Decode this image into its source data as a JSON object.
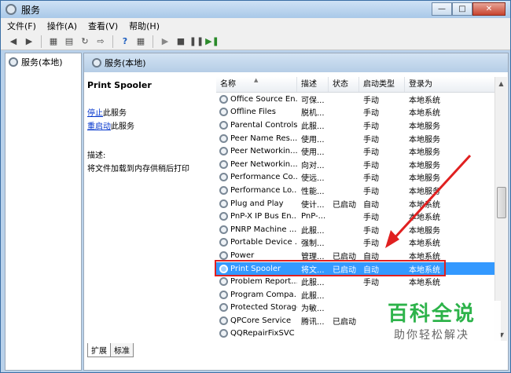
{
  "window": {
    "title": "服务"
  },
  "menu": [
    "文件(F)",
    "操作(A)",
    "查看(V)",
    "帮助(H)"
  ],
  "tree": {
    "root_label": "服务(本地)"
  },
  "main_header": {
    "title": "服务(本地)"
  },
  "details": {
    "service_name": "Print Spooler",
    "stop_link": "停止",
    "stop_suffix": "此服务",
    "restart_link": "重启动",
    "restart_suffix": "此服务",
    "desc_label": "描述:",
    "desc_text": "将文件加载到内存供稍后打印"
  },
  "columns": [
    "名称",
    "描述",
    "状态",
    "启动类型",
    "登录为"
  ],
  "rows": [
    {
      "name": "Office Source En...",
      "desc": "可保...",
      "status": "",
      "startup": "手动",
      "logon": "本地系统"
    },
    {
      "name": "Offline Files",
      "desc": "脱机...",
      "status": "",
      "startup": "手动",
      "logon": "本地系统"
    },
    {
      "name": "Parental Controls",
      "desc": "此服...",
      "status": "",
      "startup": "手动",
      "logon": "本地服务"
    },
    {
      "name": "Peer Name Res...",
      "desc": "使用...",
      "status": "",
      "startup": "手动",
      "logon": "本地服务"
    },
    {
      "name": "Peer Networkin...",
      "desc": "使用...",
      "status": "",
      "startup": "手动",
      "logon": "本地服务"
    },
    {
      "name": "Peer Networkin...",
      "desc": "向对...",
      "status": "",
      "startup": "手动",
      "logon": "本地服务"
    },
    {
      "name": "Performance Co...",
      "desc": "使远...",
      "status": "",
      "startup": "手动",
      "logon": "本地服务"
    },
    {
      "name": "Performance Lo...",
      "desc": "性能...",
      "status": "",
      "startup": "手动",
      "logon": "本地服务"
    },
    {
      "name": "Plug and Play",
      "desc": "使计...",
      "status": "已启动",
      "startup": "自动",
      "logon": "本地系统"
    },
    {
      "name": "PnP-X IP Bus En...",
      "desc": "PnP-...",
      "status": "",
      "startup": "手动",
      "logon": "本地系统"
    },
    {
      "name": "PNRP Machine ...",
      "desc": "此服...",
      "status": "",
      "startup": "手动",
      "logon": "本地服务"
    },
    {
      "name": "Portable Device ...",
      "desc": "强制...",
      "status": "",
      "startup": "手动",
      "logon": "本地系统"
    },
    {
      "name": "Power",
      "desc": "管理...",
      "status": "已启动",
      "startup": "自动",
      "logon": "本地系统"
    },
    {
      "name": "Print Spooler",
      "desc": "将文...",
      "status": "已启动",
      "startup": "自动",
      "logon": "本地系统",
      "selected": true
    },
    {
      "name": "Problem Report...",
      "desc": "此服...",
      "status": "",
      "startup": "手动",
      "logon": "本地系统"
    },
    {
      "name": "Program Compa...",
      "desc": "此服...",
      "status": "",
      "startup": "",
      "logon": ""
    },
    {
      "name": "Protected Storage",
      "desc": "为敏...",
      "status": "",
      "startup": "",
      "logon": ""
    },
    {
      "name": "QPCore Service",
      "desc": "腾讯...",
      "status": "已启动",
      "startup": "",
      "logon": ""
    },
    {
      "name": "QQRepairFixSVC",
      "desc": "",
      "status": "",
      "startup": "",
      "logon": ""
    }
  ],
  "tabs": [
    "扩展",
    "标准"
  ],
  "watermark": {
    "title": "百科全说",
    "subtitle": "助你轻松解决"
  },
  "colors": {
    "selection": "#3399ff",
    "highlight_box": "#e02020",
    "arrow": "#e02020",
    "watermark": "#2db34a"
  }
}
